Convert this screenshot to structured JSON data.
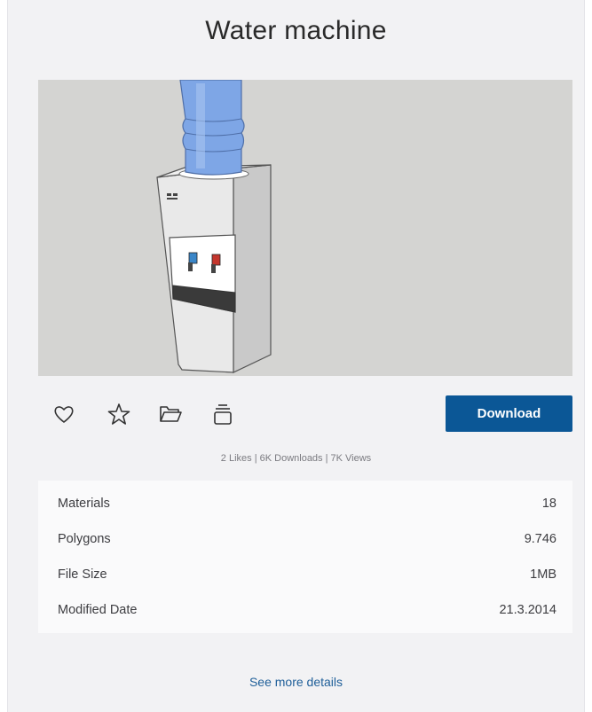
{
  "title": "Water machine",
  "actions": {
    "like_icon": "heart-icon",
    "favorite_icon": "star-icon",
    "collection_icon": "folder-icon",
    "stack_icon": "stack-icon",
    "download_label": "Download"
  },
  "stats": "2 Likes | 6K Downloads | 7K Views",
  "details": [
    {
      "label": "Materials",
      "value": "18"
    },
    {
      "label": "Polygons",
      "value": "9.746"
    },
    {
      "label": "File Size",
      "value": "1MB"
    },
    {
      "label": "Modified Date",
      "value": "21.3.2014"
    }
  ],
  "see_more": "See more details",
  "colors": {
    "primary": "#0b5796",
    "link": "#1f5f99",
    "card_bg": "#f2f2f4",
    "preview_bg": "#d4d4d2"
  }
}
